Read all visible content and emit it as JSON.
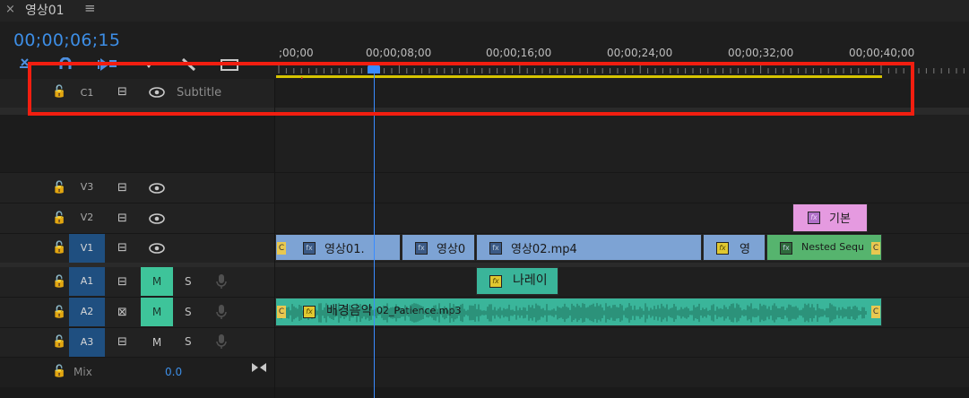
{
  "tab": {
    "title": "영상01",
    "close_glyph": "×",
    "menu_glyph": "≡"
  },
  "timecode": "00;00;06;15",
  "ruler": {
    "labels": [
      ";00;00",
      "00;00;08;00",
      "00;00;16;00",
      "00;00;24;00",
      "00;00;32;00",
      "00;00;40;00"
    ]
  },
  "tools": [
    "snap-icon",
    "linked-selection-icon",
    "add-marker-icon",
    "marker-dropdown-icon",
    "wrench-icon",
    "captions-icon"
  ],
  "caption_track": {
    "name": "C1",
    "label": "Subtitle"
  },
  "video_tracks": [
    {
      "name": "V3",
      "active": false
    },
    {
      "name": "V2",
      "active": false
    },
    {
      "name": "V1",
      "active": true
    }
  ],
  "audio_tracks": [
    {
      "name": "A1",
      "m": "M",
      "s": "S",
      "m_on": true
    },
    {
      "name": "A2",
      "m": "M",
      "s": "S",
      "m_on": true
    },
    {
      "name": "A3",
      "m": "M",
      "s": "S",
      "m_on": false
    }
  ],
  "mix": {
    "name": "Mix",
    "value": "0.0"
  },
  "clips": {
    "v2_1": "기본",
    "v1_1": "영상01.",
    "v1_2": "영상0",
    "v1_3": "영상02.mp4",
    "v1_4": "영",
    "v1_5": "Nested Sequ",
    "a1_1": "나레이",
    "a2_1": "배경음악",
    "a2_1_file": "02_Patience.mp3"
  },
  "glyphs": {
    "fx": "fx",
    "cap": "C",
    "fxv": "fx"
  },
  "colors": {
    "timecode": "#3d8ee6",
    "playhead": "#3a8bff",
    "annotation": "#f21e10",
    "video_clip": "#7da3d4",
    "nested_clip": "#56b46e",
    "audio_clip": "#3ab59a",
    "graphic_clip": "#e59ae0",
    "work_area": "#d6c400"
  }
}
